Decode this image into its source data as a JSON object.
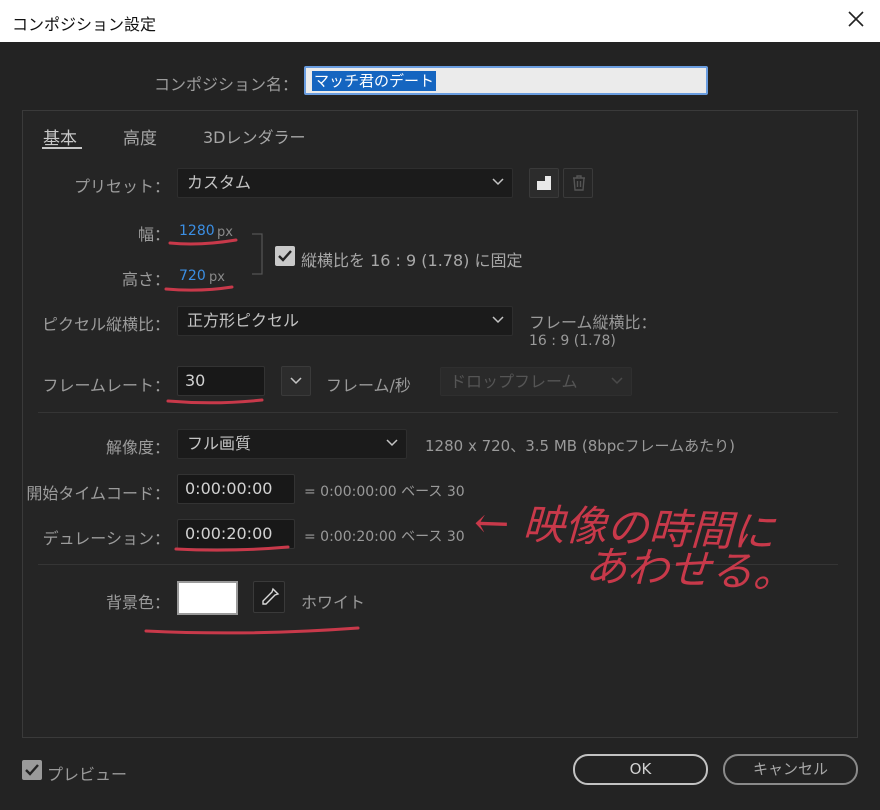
{
  "window": {
    "title": "コンポジション設定",
    "close_icon": "close-icon"
  },
  "comp_name": {
    "label": "コンポジション名：",
    "value": "マッチ君のデート"
  },
  "tabs": [
    "基本",
    "高度",
    "3Dレンダラー"
  ],
  "preset": {
    "label": "プリセット：",
    "value": "カスタム"
  },
  "width": {
    "label": "幅：",
    "value": "1280",
    "unit": "px"
  },
  "height": {
    "label": "高さ：",
    "value": "720",
    "unit": "px"
  },
  "aspect_lock": {
    "label": "縦横比を 16 : 9 (1.78) に固定",
    "checked": true
  },
  "pixel_aspect": {
    "label": "ピクセル縦横比：",
    "value": "正方形ピクセル"
  },
  "frame_aspect": {
    "label": "フレーム縦横比：",
    "value": "16 : 9 (1.78)"
  },
  "frame_rate": {
    "label": "フレームレート：",
    "value": "30",
    "unit": "フレーム/秒",
    "drop_frame": "ドロップフレーム"
  },
  "resolution": {
    "label": "解像度：",
    "value": "フル画質",
    "info": "1280 x 720、3.5 MB (8bpcフレームあたり)"
  },
  "start_timecode": {
    "label": "開始タイムコード：",
    "value": "0:00:00:00",
    "info": "= 0:00:00:00  ベース 30"
  },
  "duration": {
    "label": "デュレーション：",
    "value": "0:00:20:00",
    "info": "= 0:00:20:00  ベース 30"
  },
  "background": {
    "label": "背景色：",
    "color": "#ffffff",
    "name": "ホワイト"
  },
  "annotation": {
    "line1": "← 映像の時間に",
    "line2": "あわせる。"
  },
  "preview": {
    "label": "プレビュー",
    "checked": true
  },
  "buttons": {
    "ok": "OK",
    "cancel": "キャンセル"
  },
  "colors": {
    "accent": "#3b8fe4",
    "annotation": "#c8394a",
    "name_highlight": "#1565c0"
  }
}
